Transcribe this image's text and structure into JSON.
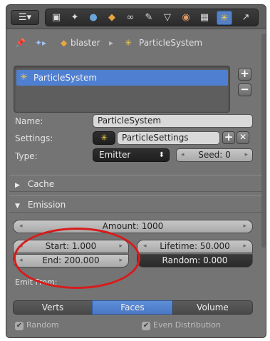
{
  "header": {
    "editor_icon": "editor-type-icon",
    "tabs": [
      {
        "icon": "render-icon",
        "glyph": "▣"
      },
      {
        "icon": "scene-icon",
        "glyph": "✦"
      },
      {
        "icon": "world-icon",
        "glyph": "●"
      },
      {
        "icon": "object-icon",
        "glyph": "◆"
      },
      {
        "icon": "constraints-icon",
        "glyph": "⛓"
      },
      {
        "icon": "modifiers-icon",
        "glyph": "🔧"
      },
      {
        "icon": "data-icon",
        "glyph": "▽"
      },
      {
        "icon": "material-icon",
        "glyph": "◉"
      },
      {
        "icon": "texture-icon",
        "glyph": "▦"
      },
      {
        "icon": "particles-icon",
        "glyph": "✳"
      },
      {
        "icon": "physics-icon",
        "glyph": "↗"
      }
    ],
    "active_tab": "particles-icon"
  },
  "path": {
    "object": "blaster",
    "system": "ParticleSystem"
  },
  "list": {
    "items": [
      "ParticleSystem"
    ]
  },
  "fields": {
    "name_label": "Name:",
    "name_value": "ParticleSystem",
    "settings_label": "Settings:",
    "settings_value": "ParticleSettings",
    "type_label": "Type:",
    "type_value": "Emitter",
    "seed": "Seed: 0"
  },
  "sections": {
    "cache": "Cache",
    "emission": "Emission"
  },
  "emission": {
    "amount": "Amount: 1000",
    "start": "Start: 1.000",
    "end": "End: 200.000",
    "lifetime": "Lifetime: 50.000",
    "random": "Random: 0.000",
    "emit_from_label": "Emit From:",
    "emit_from_options": [
      "Verts",
      "Faces",
      "Volume"
    ],
    "emit_from_selected": "Faces",
    "random_check": "Random",
    "even_distribution_check": "Even Distribution"
  },
  "colors": {
    "accent": "#4f7fd1",
    "highlight_ring": "#d81b1b"
  }
}
